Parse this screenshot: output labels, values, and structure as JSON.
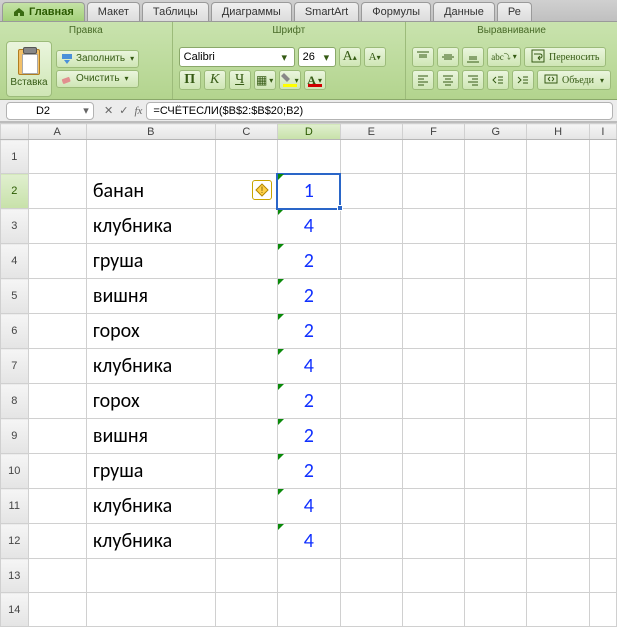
{
  "ribbon": {
    "tabs": [
      "Главная",
      "Макет",
      "Таблицы",
      "Диаграммы",
      "SmartArt",
      "Формулы",
      "Данные",
      "Ре"
    ],
    "active_tab": 0,
    "edit_group": {
      "title": "Правка",
      "paste": "Вставка",
      "fill": "Заполнить",
      "clear": "Очистить"
    },
    "font_group": {
      "title": "Шрифт",
      "font_name": "Calibri",
      "font_size": "26",
      "bold": "П",
      "italic": "К",
      "underline": "Ч",
      "grow": "A",
      "shrink": "A",
      "fill_letter": "A",
      "font_color_letter": "A",
      "border_glyph": "▦"
    },
    "align_group": {
      "title": "Выравнивание",
      "abc": "abc",
      "wrap": "Переносить",
      "merge": "Объеди"
    }
  },
  "formula_bar": {
    "name_box": "D2",
    "fx": "fx",
    "formula": "=СЧЁТЕСЛИ($B$2:$B$20;B2)"
  },
  "sheet": {
    "col_headers": [
      "A",
      "B",
      "C",
      "D",
      "E",
      "F",
      "G",
      "H",
      "I"
    ],
    "selected_col": 3,
    "selected_row": 2,
    "rows": [
      {
        "r": 1,
        "b": "",
        "d": ""
      },
      {
        "r": 2,
        "b": "банан",
        "d": "1"
      },
      {
        "r": 3,
        "b": "клубника",
        "d": "4"
      },
      {
        "r": 4,
        "b": "груша",
        "d": "2"
      },
      {
        "r": 5,
        "b": "вишня",
        "d": "2"
      },
      {
        "r": 6,
        "b": "горох",
        "d": "2"
      },
      {
        "r": 7,
        "b": "клубника",
        "d": "4"
      },
      {
        "r": 8,
        "b": "горох",
        "d": "2"
      },
      {
        "r": 9,
        "b": "вишня",
        "d": "2"
      },
      {
        "r": 10,
        "b": "груша",
        "d": "2"
      },
      {
        "r": 11,
        "b": "клубника",
        "d": "4"
      },
      {
        "r": 12,
        "b": "клубника",
        "d": "4"
      },
      {
        "r": 13,
        "b": "",
        "d": ""
      },
      {
        "r": 14,
        "b": "",
        "d": ""
      }
    ]
  }
}
